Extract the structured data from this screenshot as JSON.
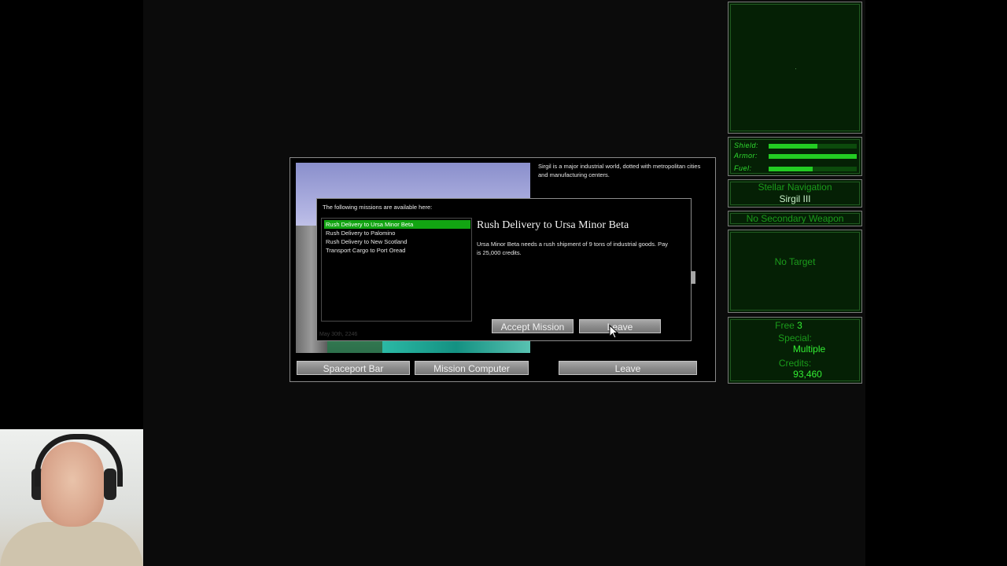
{
  "planet": {
    "description": "Sirgil is a major industrial world, dotted with metropolitan cities and manufacturing centers.",
    "date": "May 30th, 2246",
    "buttons": {
      "spaceport_bar": "Spaceport Bar",
      "mission_computer": "Mission Computer",
      "leave": "Leave"
    }
  },
  "mission_dialog": {
    "heading": "The following missions are available here:",
    "missions": [
      "Rush Delivery to Ursa Minor Beta",
      "Rush Delivery to Palomino",
      "Rush Delivery to New Scotland",
      "Transport Cargo to Port Oread"
    ],
    "selected_index": 0,
    "title": "Rush Delivery to Ursa Minor Beta",
    "description": "Ursa Minor Beta needs a rush shipment of 9 tons of industrial goods. Pay is 25,000 credits.",
    "accept_label": "Accept Mission",
    "leave_label": "Leave"
  },
  "hud": {
    "status": {
      "shield_label": "Shield:",
      "shield_level": 0.55,
      "armor_label": "Armor:",
      "armor_level": 1.0,
      "fuel_label": "Fuel:",
      "fuel_level": 0.5
    },
    "navigation": {
      "label": "Stellar Navigation",
      "destination": "Sirgil III"
    },
    "secondary_weapon": "No Secondary Weapon",
    "target": "No Target",
    "cargo": {
      "free_label": "Free",
      "free_value": "3",
      "special_label": "Special:",
      "special_value": "Multiple",
      "credits_label": "Credits:",
      "credits_value": "93,460"
    },
    "colors": {
      "panel_bg": "#052005",
      "label_green": "#1b9b1b",
      "value_green": "#33ee33",
      "bar_green": "#22cc22",
      "selection_green": "#12a512"
    }
  }
}
